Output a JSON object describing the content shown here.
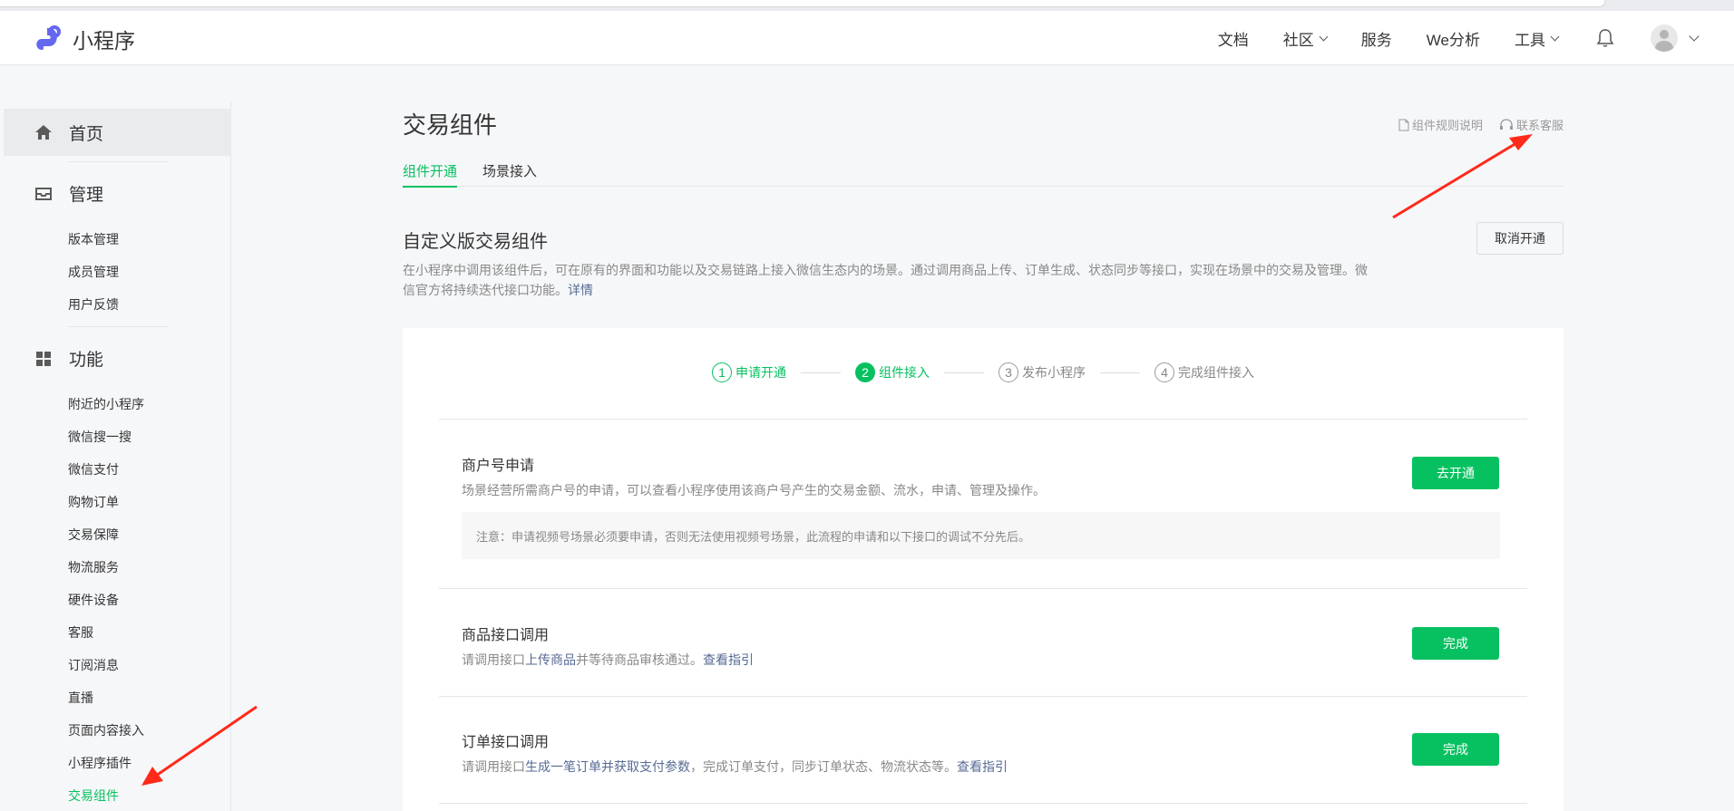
{
  "header": {
    "brand": "小程序",
    "nav": [
      {
        "label": "文档",
        "dropdown": false
      },
      {
        "label": "社区",
        "dropdown": true
      },
      {
        "label": "服务",
        "dropdown": false
      },
      {
        "label": "We分析",
        "dropdown": false
      },
      {
        "label": "工具",
        "dropdown": true
      }
    ],
    "icons": [
      "bell-icon",
      "avatar",
      "chevron-down-icon"
    ]
  },
  "sidebar": {
    "home": "首页",
    "manage": {
      "label": "管理",
      "items": [
        "版本管理",
        "成员管理",
        "用户反馈"
      ]
    },
    "features": {
      "label": "功能",
      "items": [
        "附近的小程序",
        "微信搜一搜",
        "微信支付",
        "购物订单",
        "交易保障",
        "物流服务",
        "硬件设备",
        "客服",
        "订阅消息",
        "直播",
        "页面内容接入",
        "小程序插件",
        "交易组件"
      ],
      "active": "交易组件"
    }
  },
  "main": {
    "title": "交易组件",
    "links": {
      "rules": "组件规则说明",
      "support": "联系客服"
    },
    "tabs": [
      {
        "label": "组件开通",
        "active": true
      },
      {
        "label": "场景接入",
        "active": false
      }
    ],
    "section": {
      "title": "自定义版交易组件",
      "desc_line1": "在小程序中调用该组件后，可在原有的界面和功能以及交易链路上接入微信生态内的场景。通过调用商品上传、订单生成、状态同步等接口，实现在场景中的交易及管理。微",
      "desc_line2": "信官方将持续迭代接口功能。",
      "desc_link": "详情",
      "cancel_button": "取消开通"
    },
    "steps": [
      {
        "num": "1",
        "label": "申请开通",
        "state": "done"
      },
      {
        "num": "2",
        "label": "组件接入",
        "state": "current"
      },
      {
        "num": "3",
        "label": "发布小程序",
        "state": "pending"
      },
      {
        "num": "4",
        "label": "完成组件接入",
        "state": "pending"
      }
    ],
    "items": [
      {
        "title": "商户号申请",
        "desc": "场景经营所需商户号的申请，可以查看小程序使用该商户号产生的交易金额、流水，申请、管理及操作。",
        "note": "注意：申请视频号场景必须要申请，否则无法使用视频号场景，此流程的申请和以下接口的调试不分先后。",
        "button": "去开通"
      },
      {
        "title": "商品接口调用",
        "desc_pre": "请调用接口",
        "desc_link1": "上传商品",
        "desc_mid": "并等待商品审核通过。",
        "desc_link2": "查看指引",
        "button": "完成"
      },
      {
        "title": "订单接口调用",
        "desc_pre": "请调用接口",
        "desc_link1": "生成一笔订单并获取支付参数",
        "desc_mid": "，完成订单支付，同步订单状态、物流状态等。",
        "desc_link2": "查看指引",
        "button": "完成"
      }
    ]
  },
  "colors": {
    "accent": "#07c160",
    "link": "#576b95",
    "annotation": "#ff2a1a"
  }
}
